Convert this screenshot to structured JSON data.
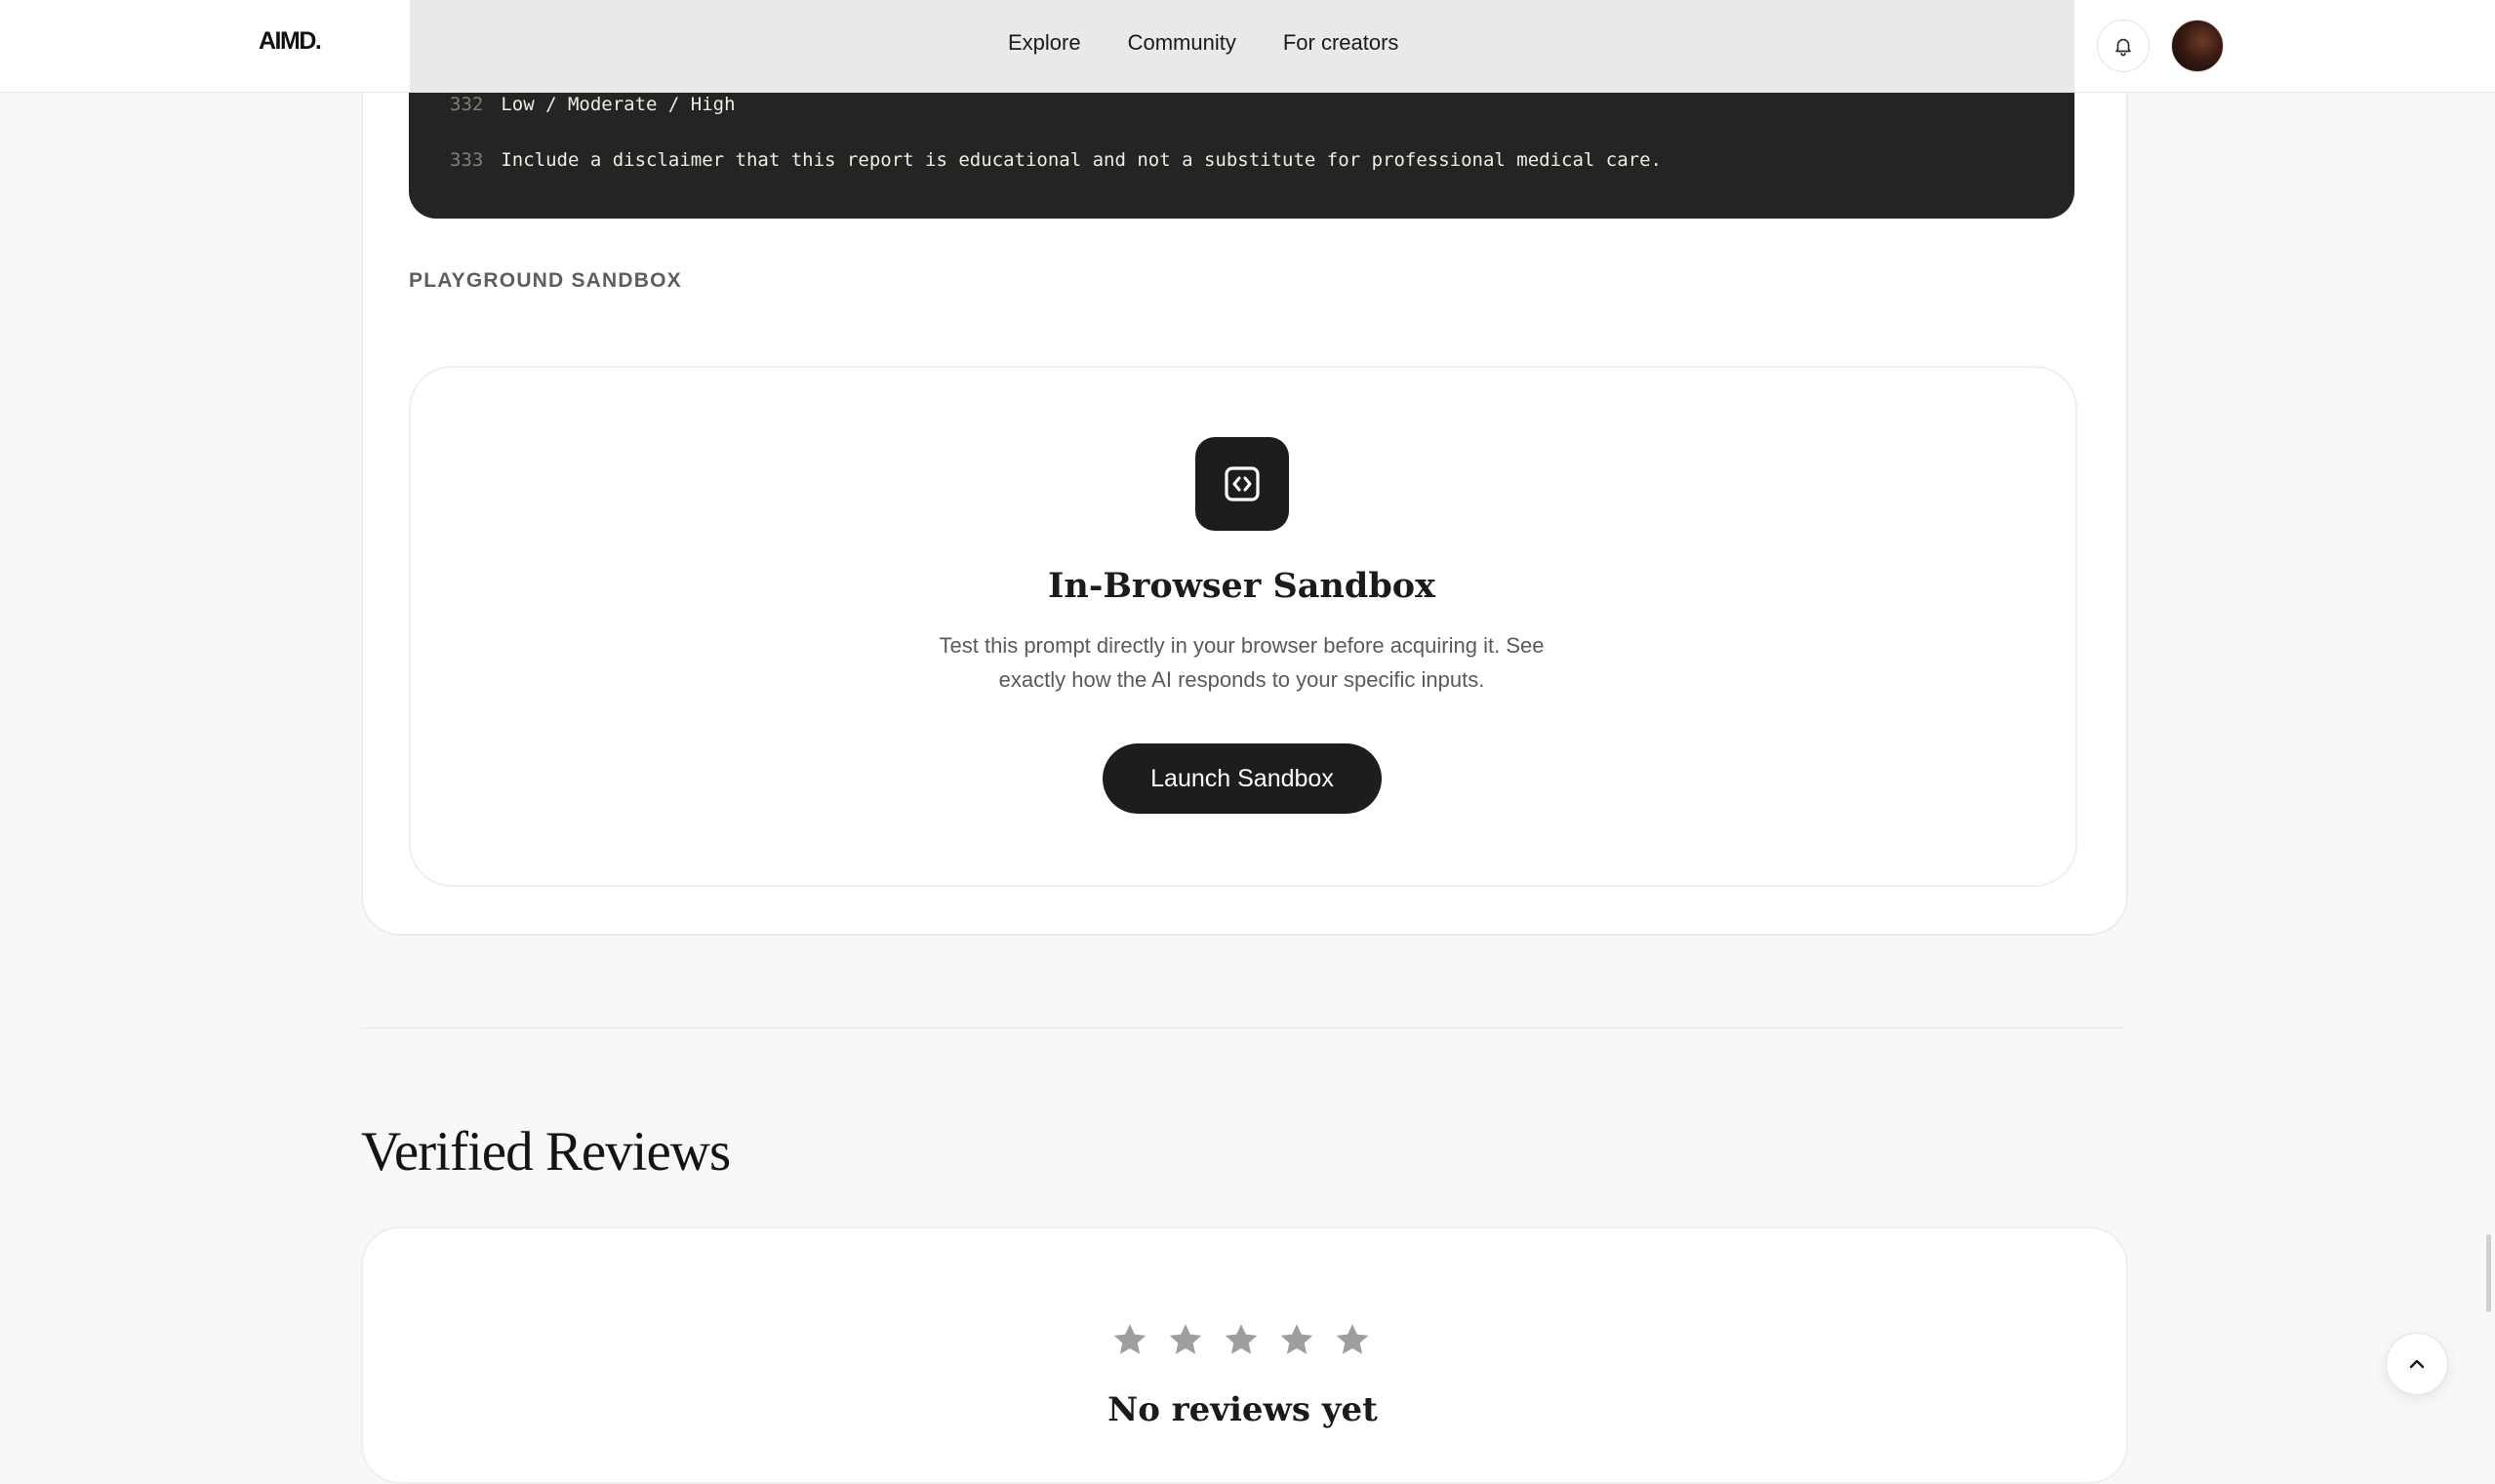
{
  "header": {
    "logo": "AIMD.",
    "nav": [
      "Explore",
      "Community",
      "For creators"
    ]
  },
  "code": {
    "lines": [
      {
        "number": "332",
        "text": "Low / Moderate / High"
      },
      {
        "number": "333",
        "text": "Include a disclaimer that this report is educational and not a substitute for professional medical care."
      }
    ]
  },
  "playground": {
    "section_label": "PLAYGROUND SANDBOX",
    "icon": "code-icon",
    "title": "In-Browser Sandbox",
    "description_line1": "Test this prompt directly in your browser before acquiring it. See",
    "description_line2": "exactly how the AI responds to your specific inputs.",
    "button_label": "Launch Sandbox"
  },
  "reviews": {
    "title": "Verified Reviews",
    "rating": 0,
    "empty_title": "No reviews yet"
  },
  "colors": {
    "accent": "#1d1d1d",
    "code_bg": "#222522",
    "star_empty": "#9e9e9c",
    "page_bg": "#f8f8f7"
  }
}
